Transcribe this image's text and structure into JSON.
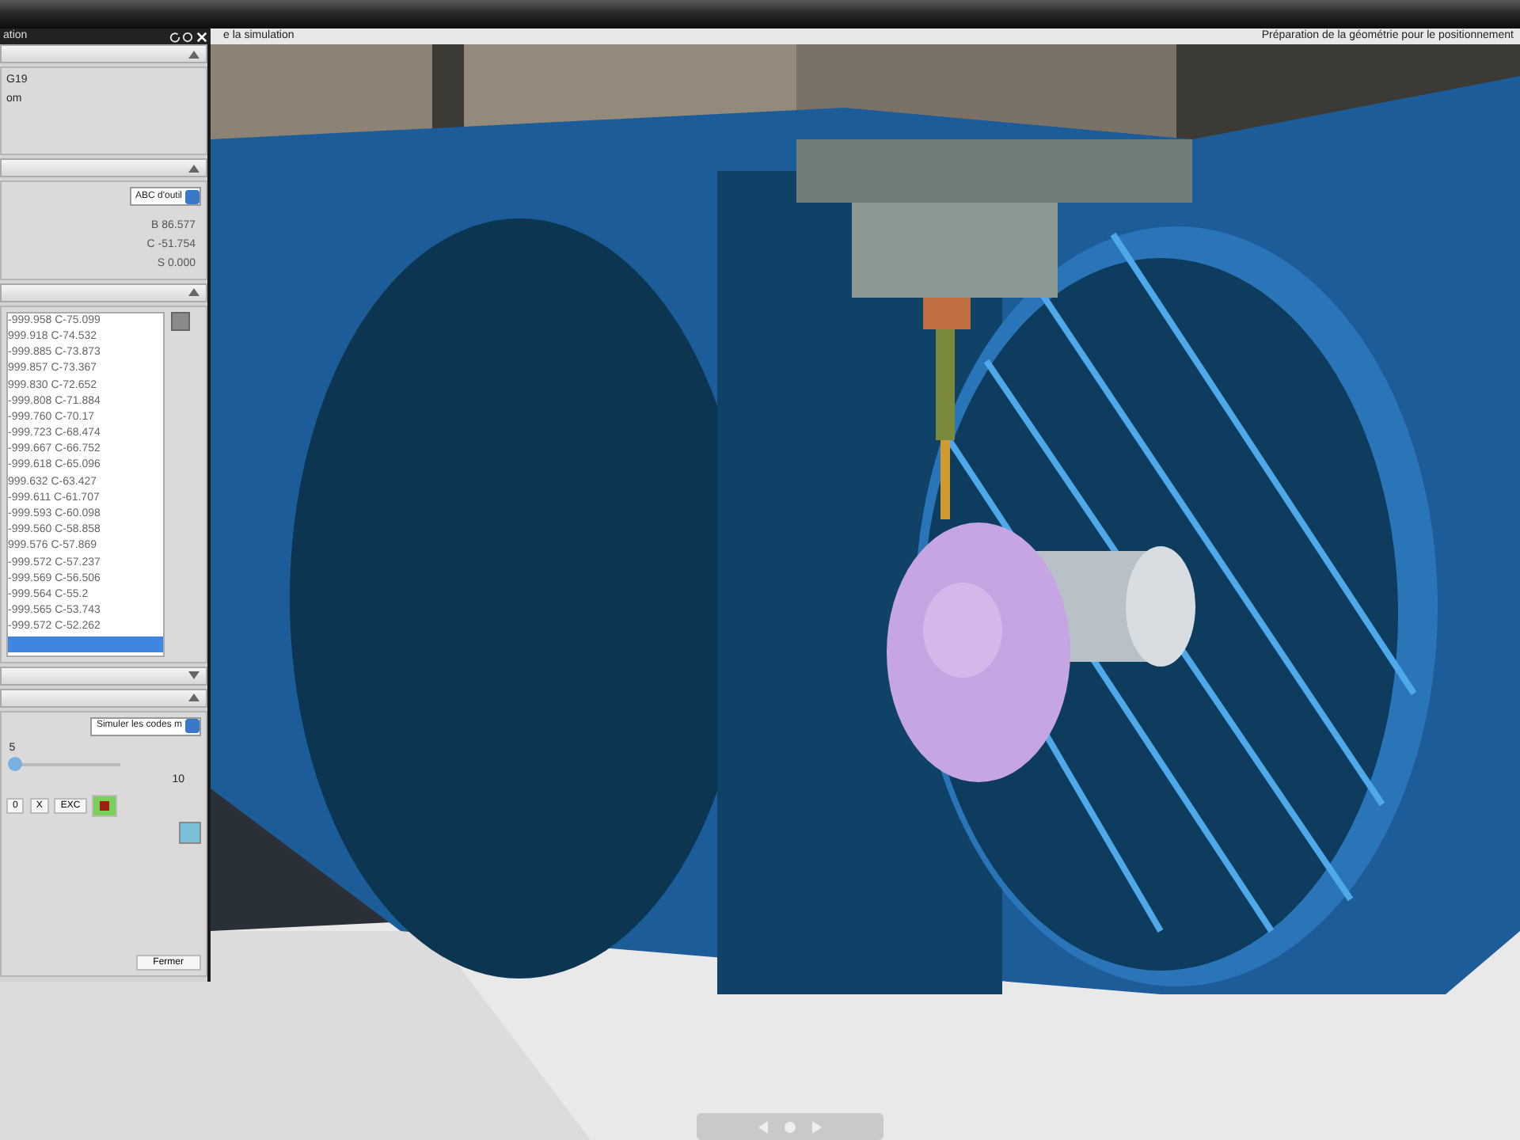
{
  "window": {
    "title": "ation",
    "view_title_left": "e la simulation",
    "view_title_right": "Préparation de la géométrie pour le positionnement"
  },
  "panel": {
    "section_1": {
      "lines": [
        "G19",
        "om"
      ]
    },
    "section_2": {
      "dropdown": "ABC d'outil",
      "readouts": [
        "B 86.577",
        "C -51.754",
        "S 0.000"
      ]
    },
    "section_3": {
      "rows": [
        {
          "text": "-999.958 C-75.099",
          "selected": false
        },
        {
          "text": "999.918 C-74.532",
          "selected": false
        },
        {
          "text": "-999.885 C-73.873",
          "selected": false
        },
        {
          "text": "999.857 C-73.367",
          "selected": false
        },
        {
          "text": "999.830 C-72.652",
          "selected": false
        },
        {
          "text": "-999.808 C-71.884",
          "selected": false
        },
        {
          "text": "-999.760 C-70.17",
          "selected": false
        },
        {
          "text": "-999.723 C-68.474",
          "selected": false
        },
        {
          "text": "-999.667 C-66.752",
          "selected": false
        },
        {
          "text": "-999.618 C-65.096",
          "selected": false
        },
        {
          "text": "999.632 C-63.427",
          "selected": false
        },
        {
          "text": "-999.611 C-61.707",
          "selected": false
        },
        {
          "text": "-999.593 C-60.098",
          "selected": false
        },
        {
          "text": "-999.560 C-58.858",
          "selected": false
        },
        {
          "text": "999.576 C-57.869",
          "selected": false
        },
        {
          "text": "-999.572 C-57.237",
          "selected": false
        },
        {
          "text": "-999.569 C-56.506",
          "selected": false
        },
        {
          "text": "-999.564 C-55.2",
          "selected": false
        },
        {
          "text": "-999.565 C-53.743",
          "selected": false
        },
        {
          "text": "-999.572 C-52.262",
          "selected": false
        },
        {
          "selected": true
        }
      ]
    },
    "section_4": {
      "dropdown": "Simuler les codes m",
      "slider": {
        "min_label": "5",
        "level": 0.05,
        "max_label": "10"
      },
      "buttons": [
        "0",
        "X",
        "EXC"
      ],
      "close_button": "Fermer"
    }
  }
}
